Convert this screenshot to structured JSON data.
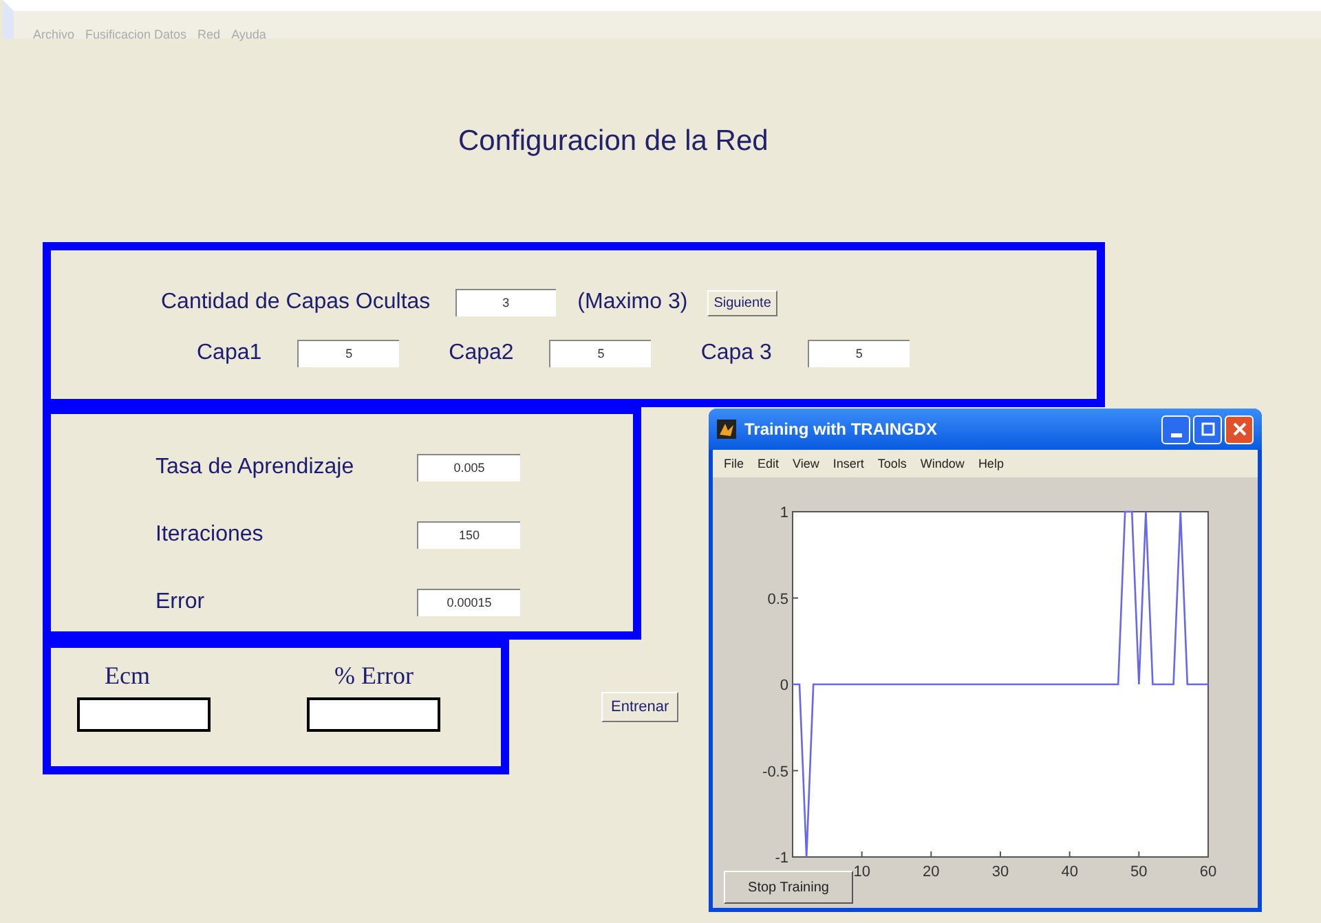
{
  "menu": [
    "Archivo",
    "Fusificacion Datos",
    "Red",
    "Ayuda"
  ],
  "title": "Configuracion de la Red",
  "layers_panel": {
    "count_label": "Cantidad de Capas Ocultas",
    "count_value": "3",
    "max_label": "(Maximo 3)",
    "next_button": "Siguiente",
    "layers": [
      {
        "label": "Capa1",
        "value": "5"
      },
      {
        "label": "Capa2",
        "value": "5"
      },
      {
        "label": "Capa 3",
        "value": "5"
      }
    ]
  },
  "params_panel": [
    {
      "label": "Tasa de Aprendizaje",
      "value": "0.005"
    },
    {
      "label": "Iteraciones",
      "value": "150"
    },
    {
      "label": "Error",
      "value": "0.00015"
    }
  ],
  "results_panel": [
    {
      "label": "Ecm"
    },
    {
      "label": "% Error"
    }
  ],
  "train_button": "Entrenar",
  "training_window": {
    "title": "Training with TRAINGDX",
    "menu": [
      "File",
      "Edit",
      "View",
      "Insert",
      "Tools",
      "Window",
      "Help"
    ],
    "stop_button": "Stop Training",
    "chart_data": {
      "type": "line",
      "x": [
        0,
        1,
        2,
        3,
        47,
        48,
        49,
        50,
        51,
        52,
        55,
        56,
        57,
        60
      ],
      "series": [
        {
          "color": "#6666ee",
          "values": [
            0,
            0,
            -1,
            0,
            0,
            1,
            1,
            0,
            1,
            0,
            0,
            1,
            0,
            0
          ]
        }
      ],
      "xlim": [
        0,
        60
      ],
      "ylim": [
        -1,
        1
      ],
      "xticks": [
        10,
        20,
        30,
        40,
        50,
        60
      ],
      "yticks": [
        -1,
        -0.5,
        0,
        0.5,
        1
      ]
    }
  }
}
